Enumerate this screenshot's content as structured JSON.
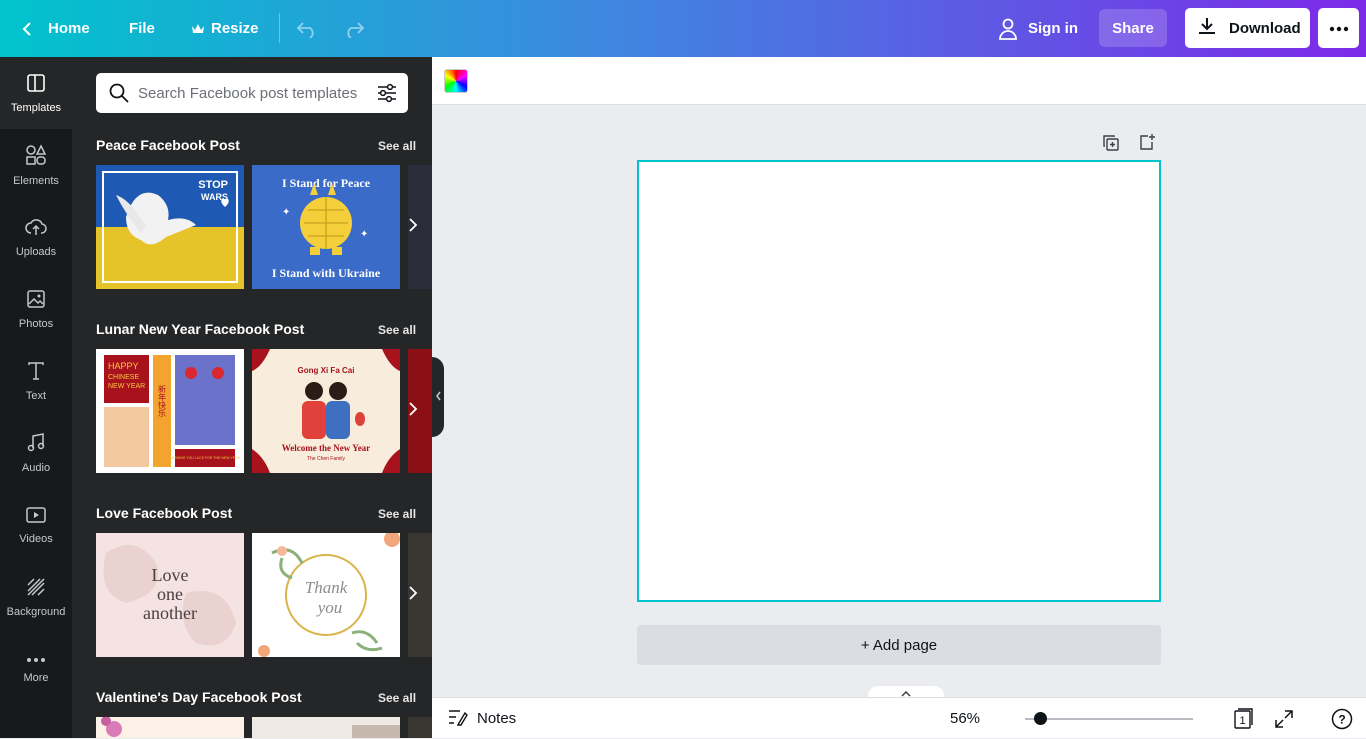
{
  "topbar": {
    "home_label": "Home",
    "file_label": "File",
    "resize_label": "Resize",
    "signin_label": "Sign in",
    "share_label": "Share",
    "download_label": "Download"
  },
  "sidebar": {
    "items": [
      {
        "label": "Templates",
        "icon": "templates-icon",
        "active": true
      },
      {
        "label": "Elements",
        "icon": "elements-icon"
      },
      {
        "label": "Uploads",
        "icon": "upload-cloud-icon"
      },
      {
        "label": "Photos",
        "icon": "photo-icon"
      },
      {
        "label": "Text",
        "icon": "text-icon"
      },
      {
        "label": "Audio",
        "icon": "music-note-icon"
      },
      {
        "label": "Videos",
        "icon": "video-icon"
      },
      {
        "label": "Background",
        "icon": "background-pattern-icon"
      },
      {
        "label": "More",
        "icon": "more-dots-icon"
      }
    ]
  },
  "panel": {
    "search_placeholder": "Search Facebook post templates",
    "sections": [
      {
        "title": "Peace Facebook Post",
        "see_all": "See all",
        "thumbs": [
          {
            "line1": "STOP",
            "line2": "WARS"
          },
          {
            "top": "I Stand for Peace",
            "bottom": "I Stand with Ukraine"
          }
        ]
      },
      {
        "title": "Lunar New Year Facebook Post",
        "see_all": "See all",
        "thumbs": [
          {
            "line1": "HAPPY",
            "line2": "CHINESE",
            "line3": "NEW YEAR",
            "cjk": "新年快乐",
            "footer": "WISHING YOU LUCK FOR THE NEW YEAR"
          },
          {
            "top": "Gong Xi Fa Cai",
            "bottom": "Welcome the New Year",
            "sub": "The Chen Family"
          }
        ]
      },
      {
        "title": "Love Facebook Post",
        "see_all": "See all",
        "thumbs": [
          {
            "line1": "Love",
            "line2": "one",
            "line3": "another"
          },
          {
            "line1": "Thank",
            "line2": "you"
          }
        ]
      },
      {
        "title": "Valentine's Day Facebook Post",
        "see_all": "See all",
        "thumbs": [
          {},
          {}
        ]
      }
    ]
  },
  "canvas": {
    "add_page_label": "+ Add page"
  },
  "bottombar": {
    "notes_label": "Notes",
    "zoom": "56%",
    "page_count": "1"
  },
  "colors": {
    "accent": "#00c4cc",
    "gradient_start": "#00c4cc",
    "gradient_end": "#7d2ae8",
    "sidebar_bg": "#18191b",
    "panel_bg": "#252627"
  }
}
